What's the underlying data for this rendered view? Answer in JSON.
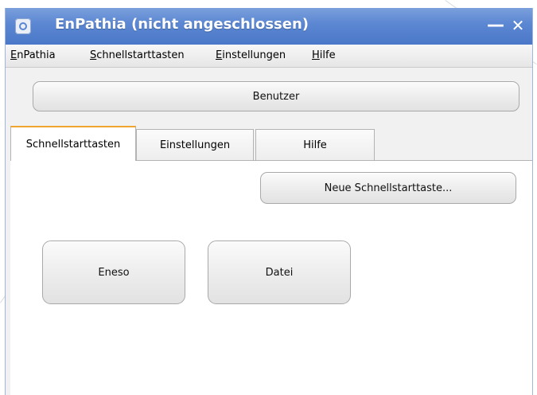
{
  "window": {
    "title": "EnPathia (nicht angeschlossen)",
    "minimize_glyph": "—",
    "close_glyph": "✕"
  },
  "menu": {
    "items": [
      {
        "underline": "E",
        "rest": "nPathia"
      },
      {
        "underline": "S",
        "rest": "chnellstarttasten"
      },
      {
        "underline": "E",
        "rest": "instellungen"
      },
      {
        "underline": "H",
        "rest": "ilfe"
      }
    ]
  },
  "user_button": "Benutzer",
  "tabs": [
    "Schnellstarttasten",
    "Einstellungen",
    "Hilfe"
  ],
  "active_tab": "Schnellstarttasten",
  "panel": {
    "new_shortcut_button": "Neue Schnellstarttaste...",
    "shortcuts": [
      "Eneso",
      "Datei"
    ]
  },
  "colors": {
    "titlebar": "#5a86d2",
    "active_tab_accent": "#f0a531"
  }
}
